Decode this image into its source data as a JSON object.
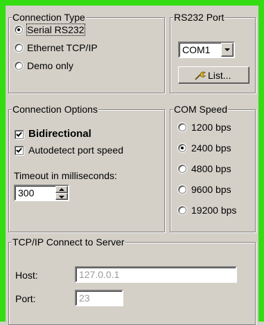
{
  "connection_type": {
    "title": "Connection Type",
    "options": [
      "Serial RS232",
      "Ethernet TCP/IP",
      "Demo only"
    ],
    "selected": "Serial RS232"
  },
  "rs232_port": {
    "title": "RS232 Port",
    "port_value": "COM1",
    "list_button": "List..."
  },
  "connection_options": {
    "title": "Connection Options",
    "bidirectional_label": "Bidirectional",
    "bidirectional_checked": true,
    "autodetect_label": "Autodetect port speed",
    "autodetect_checked": true,
    "timeout_label": "Timeout in milliseconds:",
    "timeout_value": "300"
  },
  "com_speed": {
    "title": "COM Speed",
    "options": [
      "1200 bps",
      "2400 bps",
      "4800 bps",
      "9600 bps",
      "19200 bps"
    ],
    "selected": "2400 bps"
  },
  "tcpip": {
    "title": "TCP/IP Connect to Server",
    "host_label": "Host:",
    "host_value": "127.0.0.1",
    "port_label": "Port:",
    "port_value": "23"
  },
  "colors": {
    "window_border": "#33dd11",
    "face": "#d4d0c8"
  }
}
